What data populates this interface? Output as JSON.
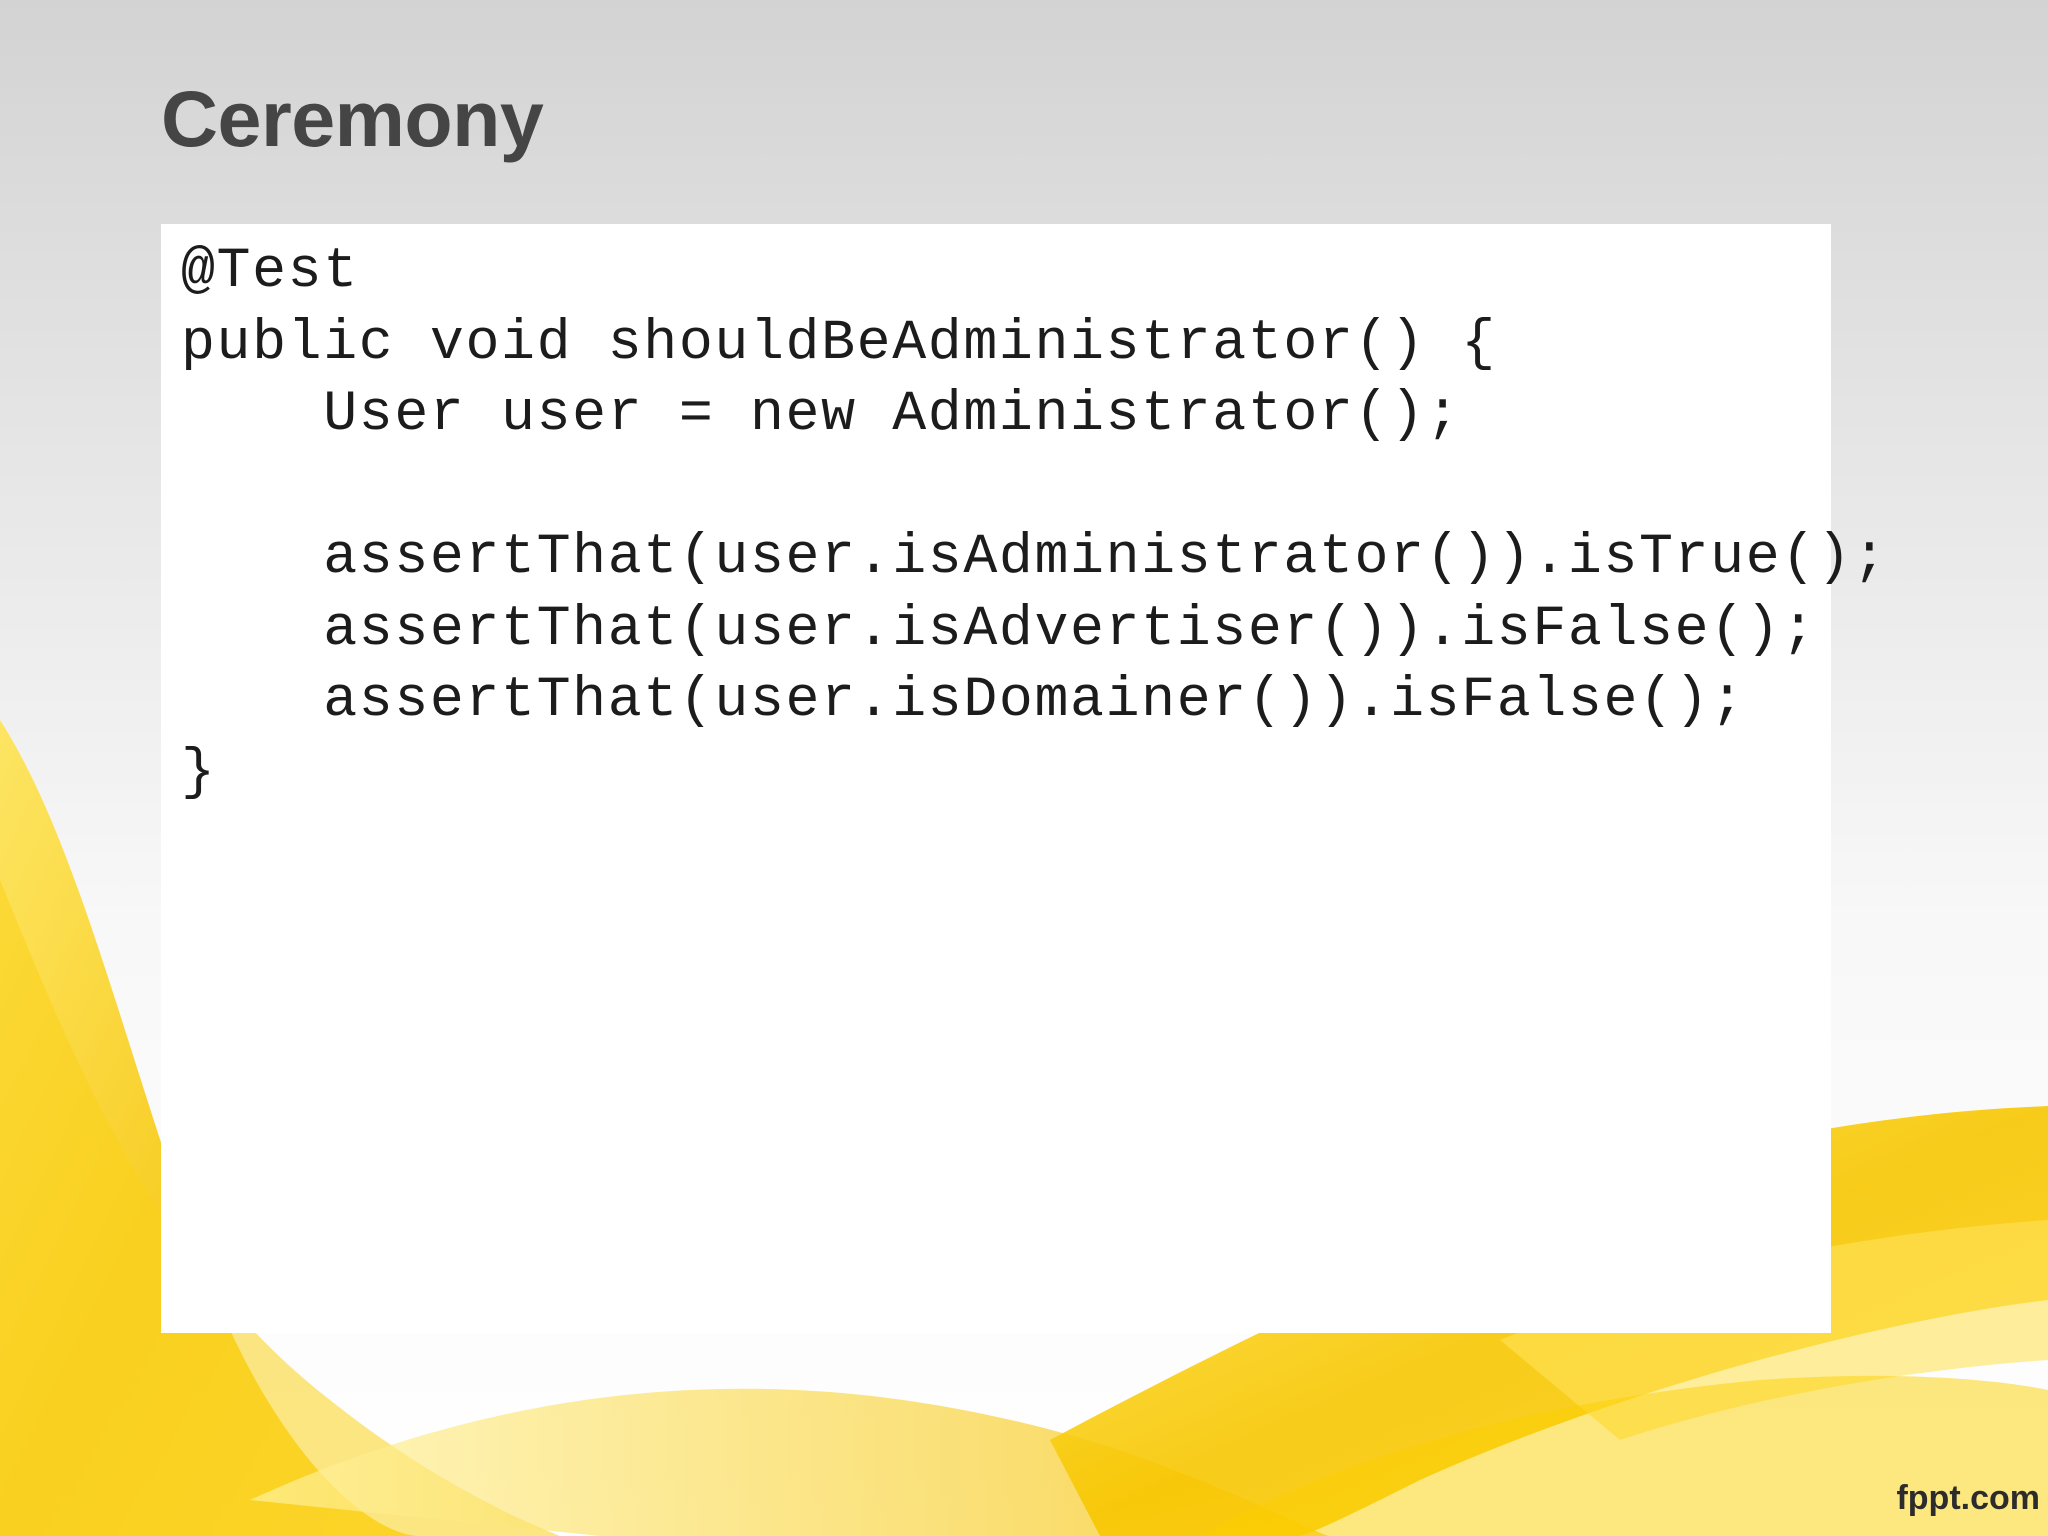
{
  "slide": {
    "title": "Ceremony",
    "code_lines": [
      "@Test",
      "public void shouldBeAdministrator() {",
      "    User user = new Administrator();",
      "",
      "    assertThat(user.isAdministrator()).isTrue();",
      "    assertThat(user.isAdvertiser()).isFalse();",
      "    assertThat(user.isDomainer()).isFalse();",
      "}"
    ],
    "brand": "fppt.com"
  },
  "colors": {
    "title": "#454545",
    "code_text": "#1c1c1c",
    "ribbon": "#f5c800"
  }
}
